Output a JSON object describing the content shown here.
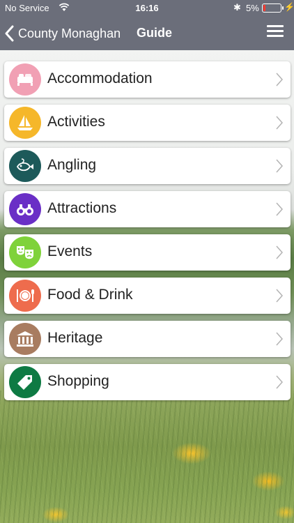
{
  "status_bar": {
    "carrier": "No Service",
    "time": "16:16",
    "battery_percent": "5%",
    "battery_level": 0.05,
    "battery_color": "#ff3b30"
  },
  "header": {
    "back_label": "County Monaghan",
    "title": "Guide",
    "background": "#6b6e7a"
  },
  "categories": [
    {
      "label": "Accommodation",
      "icon": "bed-icon",
      "color": "#f1a0b4"
    },
    {
      "label": "Activities",
      "icon": "sailboat-icon",
      "color": "#f5b72a"
    },
    {
      "label": "Angling",
      "icon": "fish-icon",
      "color": "#1d5a5a"
    },
    {
      "label": "Attractions",
      "icon": "binoculars-icon",
      "color": "#6a2fc6"
    },
    {
      "label": "Events",
      "icon": "theatre-masks-icon",
      "color": "#7fd23a"
    },
    {
      "label": "Food & Drink",
      "icon": "plate-cutlery-icon",
      "color": "#ee6c4d"
    },
    {
      "label": "Heritage",
      "icon": "museum-icon",
      "color": "#a87c60"
    },
    {
      "label": "Shopping",
      "icon": "price-tag-icon",
      "color": "#0e7a43"
    }
  ]
}
